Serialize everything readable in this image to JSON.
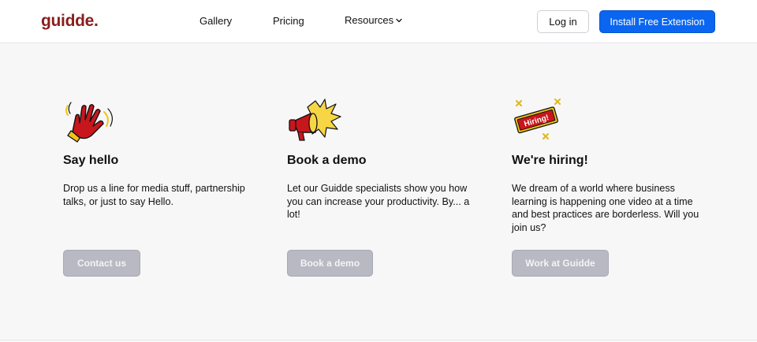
{
  "header": {
    "logo_text": "guidde.",
    "nav": {
      "gallery": "Gallery",
      "pricing": "Pricing",
      "resources": "Resources"
    },
    "login_label": "Log in",
    "install_label": "Install Free Extension"
  },
  "cards": [
    {
      "icon": "waving-hand-icon",
      "title": "Say hello",
      "description": "Drop us a line for media stuff, partnership talks, or just to say Hello.",
      "button": "Contact us"
    },
    {
      "icon": "megaphone-icon",
      "title": "Book a demo",
      "description": "Let our Guidde specialists show you how you can increase your productivity. By... a lot!",
      "button": "Book a demo"
    },
    {
      "icon": "hiring-ticket-icon",
      "title": "We're hiring!",
      "description": "We dream of a world where business learning is happening one video at a time and best practices are borderless. Will you join us?",
      "button": "Work at Guidde",
      "icon_text": "Hiring!"
    }
  ],
  "colors": {
    "brand": "#8a1d1d",
    "accent": "#0a66f0",
    "icon_red": "#c8161d",
    "icon_yellow": "#f0c419",
    "disabled_button": "#b9b9c3"
  }
}
